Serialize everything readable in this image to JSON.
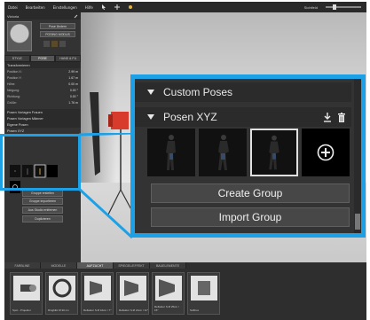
{
  "menubar": {
    "items": [
      "Datei",
      "Bearbeiten",
      "Einstellungen",
      "Hilfe"
    ],
    "slider_label": "Sichtfeld"
  },
  "left_panel": {
    "title": "Victoria",
    "portrait_buttons": [
      "Pose Ändern",
      "POSING MODUS"
    ],
    "tabs": [
      "STYLE",
      "POSE",
      "HAND & FU"
    ],
    "active_tab": "POSE",
    "transform_header": "Transformieren",
    "transform_rows": [
      {
        "label": "Position X:",
        "value": "2.99 m"
      },
      {
        "label": "Position Y:",
        "value": "1.67 m"
      },
      {
        "label": "Höhe:",
        "value": "0.00 m"
      },
      {
        "label": "Neigung:",
        "value": "0.00 °"
      },
      {
        "label": "Richtung:",
        "value": "0.00 °"
      },
      {
        "label": "Größe:",
        "value": "1.76 m"
      }
    ],
    "pose_preset_rows": [
      "Posen Vorlagen Frauen",
      "Posen Vorlagen Männer",
      "Eigene Posen",
      "Posen XYZ"
    ],
    "group_buttons": [
      "Gruppe erstellen",
      "Gruppe importieren",
      "Aus Studio entfernen",
      "Duplizieren"
    ]
  },
  "bottom_bar": {
    "tabs": [
      "FARBLINE",
      "MODELLE",
      "AUFZUCHT",
      "SPIEGEL/EFFEKT",
      "BAUELEMENTE"
    ],
    "active_tab": "AUFZUCHT",
    "library_items": [
      {
        "label": "Spot - Projektor"
      },
      {
        "label": "Ringblitz\nØ 30 cm"
      },
      {
        "label": "Reflektor S\nØ 16cm / 7°"
      },
      {
        "label": "Reflektor S\nØ 21cm / 11°"
      },
      {
        "label": "Reflektor S\nØ 25cm / 15°"
      },
      {
        "label": "Softbox"
      }
    ]
  },
  "callout": {
    "section_title": "Custom Poses",
    "group_title": "Posen XYZ",
    "pose_thumbnails": [
      {
        "name": "pose-1",
        "selected": false
      },
      {
        "name": "pose-2",
        "selected": false
      },
      {
        "name": "pose-3",
        "selected": true
      }
    ],
    "add_label": "+",
    "create_group_label": "Create Group",
    "import_group_label": "Import Group",
    "accent_color": "#1da1e6"
  }
}
